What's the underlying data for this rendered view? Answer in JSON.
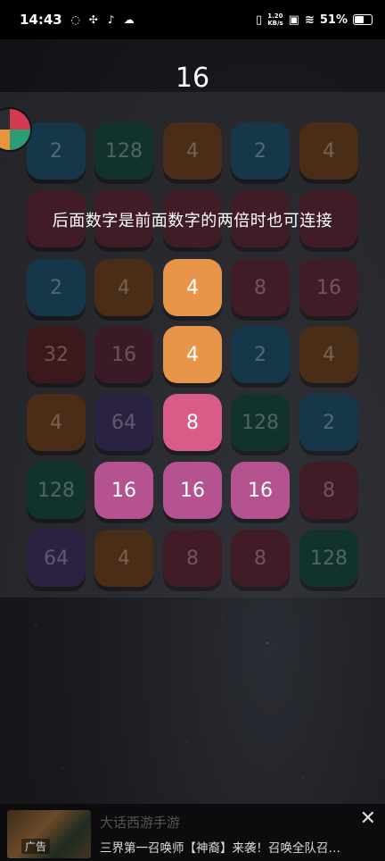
{
  "status_bar": {
    "time": "14:43",
    "net_speed_value": "1.20",
    "net_speed_unit": "KB/s",
    "battery_text": "51%",
    "battery_level": 0.51
  },
  "game": {
    "score": "16",
    "hint": "后面数字是前面数字的两倍时也可连接",
    "grid": [
      [
        {
          "value": "2",
          "color": "#16364a",
          "active": false
        },
        {
          "value": "128",
          "color": "#12332b",
          "active": false
        },
        {
          "value": "4",
          "color": "#4a2d17",
          "active": false
        },
        {
          "value": "2",
          "color": "#16364a",
          "active": false
        },
        {
          "value": "4",
          "color": "#4a2d17",
          "active": false
        }
      ],
      [
        {
          "value": "",
          "color": "#3f1c26",
          "active": false
        },
        {
          "value": "",
          "color": "#3f1c26",
          "active": false
        },
        {
          "value": "",
          "color": "#3f1c26",
          "active": false
        },
        {
          "value": "",
          "color": "#3f1c26",
          "active": false
        },
        {
          "value": "",
          "color": "#3f1c26",
          "active": false
        }
      ],
      [
        {
          "value": "2",
          "color": "#16364a",
          "active": false
        },
        {
          "value": "4",
          "color": "#4a2d17",
          "active": false
        },
        {
          "value": "4",
          "color": "#e89449",
          "active": true
        },
        {
          "value": "8",
          "color": "#3f1c26",
          "active": false
        },
        {
          "value": "16",
          "color": "#3f1c26",
          "active": false
        }
      ],
      [
        {
          "value": "32",
          "color": "#3a181c",
          "active": false
        },
        {
          "value": "16",
          "color": "#3a1a26",
          "active": false
        },
        {
          "value": "4",
          "color": "#e89449",
          "active": true
        },
        {
          "value": "2",
          "color": "#16364a",
          "active": false
        },
        {
          "value": "4",
          "color": "#4a2d17",
          "active": false
        }
      ],
      [
        {
          "value": "4",
          "color": "#4a2d17",
          "active": false
        },
        {
          "value": "64",
          "color": "#2a2240",
          "active": false
        },
        {
          "value": "8",
          "color": "#d95b87",
          "active": true
        },
        {
          "value": "128",
          "color": "#12332b",
          "active": false
        },
        {
          "value": "2",
          "color": "#16364a",
          "active": false
        }
      ],
      [
        {
          "value": "128",
          "color": "#12332b",
          "active": false
        },
        {
          "value": "16",
          "color": "#b55390",
          "active": true
        },
        {
          "value": "16",
          "color": "#b55390",
          "active": true
        },
        {
          "value": "16",
          "color": "#b55390",
          "active": true
        },
        {
          "value": "8",
          "color": "#3f1c26",
          "active": false
        }
      ],
      [
        {
          "value": "64",
          "color": "#2a2240",
          "active": false
        },
        {
          "value": "4",
          "color": "#4a2d17",
          "active": false
        },
        {
          "value": "8",
          "color": "#3f1c26",
          "active": false
        },
        {
          "value": "8",
          "color": "#3f1c26",
          "active": false
        },
        {
          "value": "128",
          "color": "#12332b",
          "active": false
        }
      ]
    ]
  },
  "ad": {
    "title": "大话西游手游",
    "description": "三界第一召唤师【神裔】来袭！召唤全队召…",
    "tag": "广告",
    "close_label": "✕"
  }
}
